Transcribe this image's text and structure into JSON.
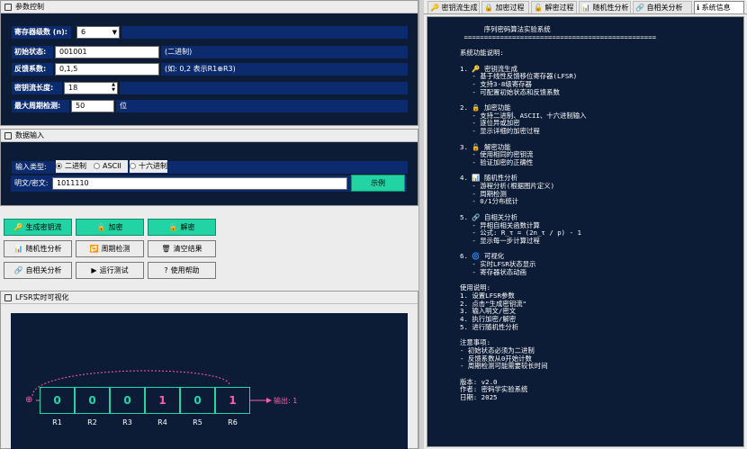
{
  "params": {
    "title": "参数控制",
    "reg_label": "寄存器级数 (n):",
    "reg_value": "6",
    "init_label": "初始状态:",
    "init_value": "001001",
    "init_note": "(二进制)",
    "fb_label": "反馈系数:",
    "fb_value": "0,1,5",
    "fb_note": "(如: 0,2 表示R1⊕R3)",
    "len_label": "密钥流长度:",
    "len_value": "18",
    "period_label": "最大周期检测:",
    "period_value": "50",
    "period_unit": "位"
  },
  "input": {
    "title": "数据输入",
    "type_label": "输入类型:",
    "options": [
      "二进制",
      "ASCII",
      "十六进制"
    ],
    "selected": "二进制",
    "text_label": "明文/密文:",
    "text_value": "1011110",
    "example_button": "示例"
  },
  "buttons": {
    "gen": "生成密钥流",
    "encrypt": "加密",
    "decrypt": "解密",
    "random": "随机性分析",
    "period": "周期检测",
    "clear": "清空结果",
    "autocorr": "自相关分析",
    "run": "运行测试",
    "help": "使用帮助"
  },
  "viz": {
    "title": "LFSR实时可视化",
    "cells": [
      "0",
      "0",
      "0",
      "1",
      "0",
      "1"
    ],
    "labels": [
      "R1",
      "R2",
      "R3",
      "R4",
      "R5",
      "R6"
    ],
    "output": "输出: 1",
    "xor": "⊕"
  },
  "tabs": [
    "密钥流生成",
    "加密过程",
    "解密过程",
    "随机性分析",
    "自相关分析",
    "系统信息"
  ],
  "active_tab": "系统信息",
  "info_text": "      序列密码算法实验系统\n ================================================\n\n系统功能说明:\n\n1. 🔑 密钥流生成\n   - 基于线性反馈移位寄存器(LFSR)\n   - 支持3-8级寄存器\n   - 可配置初始状态和反馈系数\n\n2. 🔒 加密功能\n   - 支持二进制、ASCII、十六进制输入\n   - 逐位异或加密\n   - 显示详细的加密过程\n\n3. 🔓 解密功能\n   - 使用相同的密钥流\n   - 验证加密的正确性\n\n4. 📊 随机性分析\n   - 游程分析(根据图片定义)\n   - 周期检测\n   - 0/1分布统计\n\n5. 🔗 自相关分析\n   - 异相自相关函数计算\n   - 公式: R_τ = (2n_τ / p) - 1\n   - 显示每一步计算过程\n\n6. 🌀 可视化\n   - 实时LFSR状态显示\n   - 寄存器状态动画\n\n使用说明:\n1. 设置LFSR参数\n2. 点击\"生成密钥流\"\n3. 输入明文/密文\n4. 执行加密/解密\n5. 进行随机性分析\n\n注意事项:\n- 初始状态必须为二进制\n- 反馈系数从0开始计数\n- 周期检测可能需要较长时间\n\n版本: v2.0\n作者: 密码学实验系统\n日期: 2025"
}
